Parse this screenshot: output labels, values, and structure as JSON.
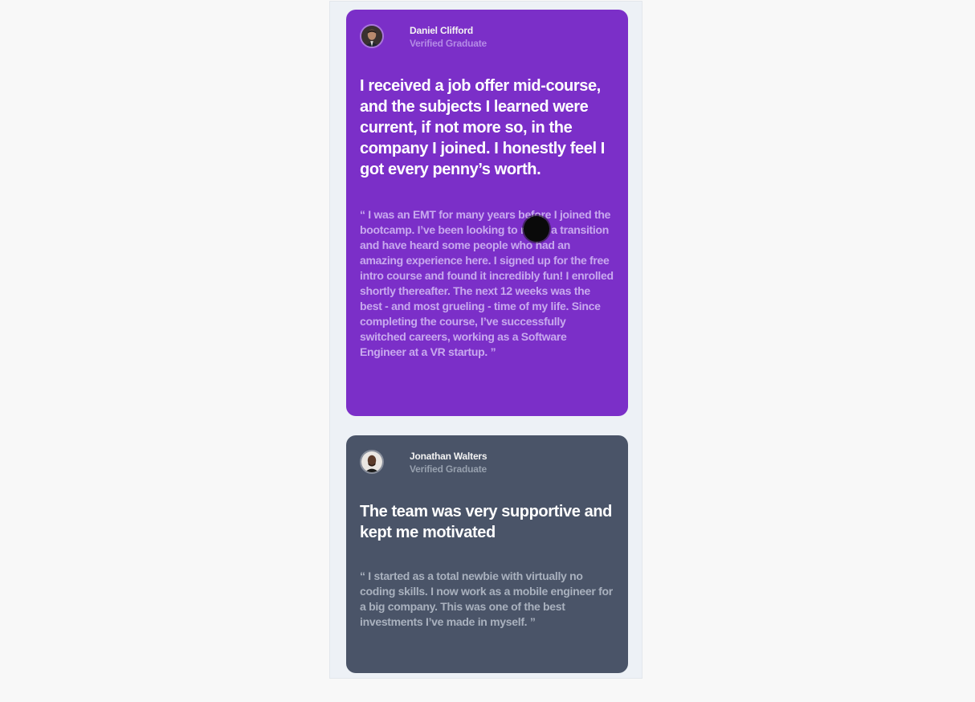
{
  "testimonials": [
    {
      "author_name": "Daniel Clifford",
      "author_role": "Verified Graduate",
      "headline": "I received a job offer mid-course, and the subjects I learned were current, if not more so, in the company I joined. I honestly feel I got every penny’s worth.",
      "quote": "“ I was an EMT for many years before I joined the bootcamp. I’ve been looking to make a transition and have heard some people who had an amazing experience here. I signed up for the free intro course and found it incredibly fun! I enrolled shortly thereafter. The next 12 weeks was the best - and most grueling - time of my life. Since completing the course, I’ve successfully switched careers, working as a Software Engineer at a VR startup. ”",
      "background_color": "#7b2fc8"
    },
    {
      "author_name": "Jonathan Walters",
      "author_role": "Verified Graduate",
      "headline": "The team was very supportive and kept me motivated",
      "quote": "“ I started as a total newbie with virtually no coding skills. I now work as a mobile engineer for a big company. This was one of the best investments I’ve made in myself. ”",
      "background_color": "#4a5468"
    }
  ],
  "icons": {
    "avatar_1": "avatar-photo-daniel",
    "avatar_2": "avatar-photo-jonathan",
    "cursor": "mouse-cursor"
  }
}
